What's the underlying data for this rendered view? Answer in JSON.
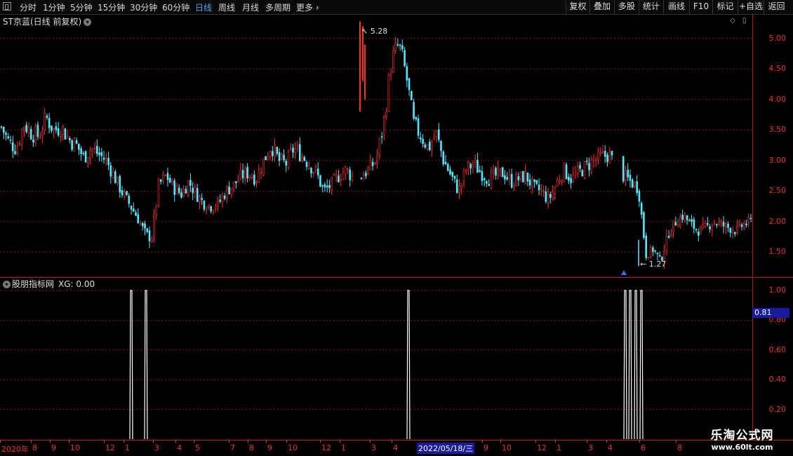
{
  "toolbar": {
    "periods": [
      "分时",
      "1分钟",
      "5分钟",
      "15分钟",
      "30分钟",
      "60分钟",
      "日线",
      "周线",
      "月线",
      "多周期",
      "更多"
    ],
    "active_period": "日线",
    "buttons": [
      "复权",
      "叠加",
      "多股",
      "统计",
      "画线",
      "F10",
      "标记",
      "+自选",
      "返回"
    ]
  },
  "main": {
    "title": "ST京蓝(日线 前复权)",
    "high_label": "5.28",
    "low_label": "1.27",
    "price_axis": [
      "5.00",
      "4.50",
      "4.00",
      "3.50",
      "3.00",
      "2.50",
      "2.00",
      "1.50"
    ]
  },
  "sub": {
    "indicator_name": "股朋指标网",
    "value_label": "XG: 0.00",
    "axis": [
      "1.00",
      "0.80",
      "0.60",
      "0.40",
      "0.20"
    ],
    "cursor_value": "0.81"
  },
  "date_axis": {
    "ticks": [
      "2020年",
      "8",
      "9",
      "10",
      "12",
      "1",
      "3",
      "4",
      "5",
      "7",
      "8",
      "9",
      "10",
      "12",
      "1",
      "3",
      "4",
      "5",
      "9",
      "10",
      "12",
      "1",
      "3",
      "4",
      "6",
      "8"
    ],
    "cursor_date": "2022/05/18/三"
  },
  "watermark": {
    "name": "乐淘公式网",
    "url": "www.60lt.com"
  },
  "colors": {
    "up": "#ff3030",
    "down": "#54e8ff",
    "axis": "#ee3333",
    "grid": "#8a1b1b",
    "signal": "#ffffff",
    "active": "#4aa3ff"
  },
  "chart_data": {
    "type": "candlestick",
    "y_range": [
      1.1,
      5.4
    ],
    "high": 5.28,
    "low": 1.27,
    "close_path": [
      3.55,
      3.3,
      3.2,
      3.6,
      3.45,
      3.4,
      3.7,
      3.5,
      3.55,
      3.35,
      3.25,
      3.05,
      3.2,
      3.1,
      3.0,
      2.75,
      2.5,
      2.3,
      2.1,
      1.85,
      1.7,
      2.6,
      2.75,
      2.55,
      2.45,
      2.65,
      2.45,
      2.3,
      2.25,
      2.3,
      2.5,
      2.6,
      2.75,
      2.8,
      2.7,
      3.0,
      3.25,
      3.0,
      2.95,
      3.2,
      3.1,
      2.95,
      2.8,
      2.5,
      2.6,
      2.75,
      2.85,
      2.7,
      2.75,
      2.85,
      3.0,
      3.6,
      4.6,
      4.9,
      4.4,
      3.6,
      3.4,
      3.2,
      3.45,
      3.0,
      2.75,
      2.5,
      2.85,
      2.95,
      2.8,
      2.7,
      2.75,
      2.8,
      2.65,
      2.7,
      2.75,
      2.55,
      2.5,
      2.35,
      2.6,
      2.85,
      2.7,
      2.8,
      2.9,
      3.0,
      3.05,
      3.1,
      2.9,
      2.75,
      2.65,
      2.55,
      1.45,
      1.55,
      1.35,
      1.8,
      2.0,
      2.1,
      1.95,
      1.85,
      1.9,
      2.0,
      1.95,
      1.9,
      1.85,
      1.95,
      2.0
    ]
  },
  "signal_data": {
    "type": "bar",
    "max": 1.0,
    "pulses_x": [
      187,
      208,
      582,
      891,
      898,
      906,
      914
    ]
  }
}
